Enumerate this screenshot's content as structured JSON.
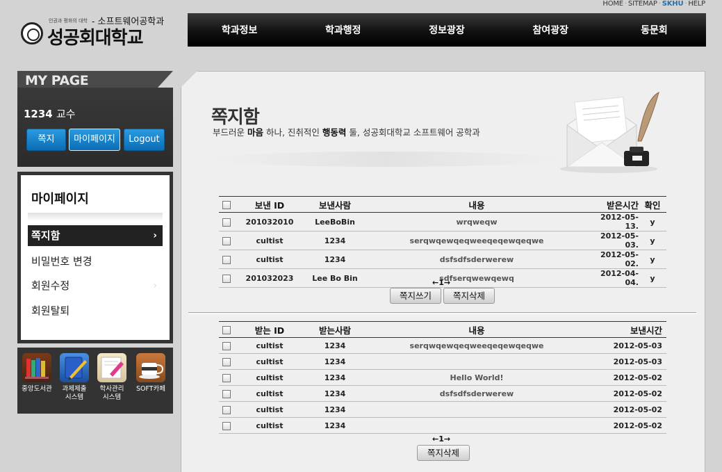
{
  "util_links": [
    "HOME",
    "SITEMAP",
    "SKHU",
    "HELP"
  ],
  "logo": {
    "tagline": "인권과 평화의 대학",
    "dept": "- 소프트웨어공학과",
    "name": "성공회대학교"
  },
  "nav": [
    "학과정보",
    "학과행정",
    "정보광장",
    "참여광장",
    "동문회"
  ],
  "mypage": {
    "title": "MY PAGE",
    "user_id": "1234",
    "user_role": "교수",
    "buttons": [
      "쪽지",
      "마이페이지",
      "Logout"
    ]
  },
  "menu": {
    "title": "마이페이지",
    "items": [
      "쪽지함",
      "비밀번호 변경",
      "회원수정",
      "회원탈퇴"
    ]
  },
  "quick_links": [
    "중앙도서관",
    "과제제출\n시스템",
    "학사관리\n시스템",
    "SOFT카페"
  ],
  "page": {
    "title": "쪽지함",
    "subtitle_parts": [
      "부드러운 ",
      "마음",
      " 하나, 진취적인 ",
      "행동력",
      " 둘, 성공회대학교 소프트웨어 공학과"
    ]
  },
  "received": {
    "headers": [
      "보낸 ID",
      "보낸사람",
      "내용",
      "받은시간",
      "확인"
    ],
    "rows": [
      [
        "201032010",
        "LeeBoBin",
        "wrqweqw",
        "2012-05-13.",
        "y"
      ],
      [
        "cultist",
        "1234",
        "serqwqewqeqweeqeqewqeqwe",
        "2012-05-03.",
        "y"
      ],
      [
        "cultist",
        "1234",
        "dsfsdfsderwerew",
        "2012-05-02.",
        "y"
      ],
      [
        "201032023",
        "Lee Bo Bin",
        "sdfserqwewqewq",
        "2012-04-04.",
        "y"
      ]
    ],
    "pager": "←1→",
    "buttons": [
      "쪽지쓰기",
      "쪽지삭제"
    ]
  },
  "sent": {
    "headers": [
      "받는 ID",
      "받는사람",
      "내용",
      "보낸시간"
    ],
    "rows": [
      [
        "cultist",
        "1234",
        "serqwqewqeqweeqeqewqeqwe",
        "2012-05-03"
      ],
      [
        "cultist",
        "1234",
        "",
        "2012-05-03"
      ],
      [
        "cultist",
        "1234",
        "Hello World!",
        "2012-05-02"
      ],
      [
        "cultist",
        "1234",
        "dsfsdfsderwerew",
        "2012-05-02"
      ],
      [
        "cultist",
        "1234",
        "",
        "2012-05-02"
      ],
      [
        "cultist",
        "1234",
        "",
        "2012-05-02"
      ]
    ],
    "pager": "←1→",
    "buttons": [
      "쪽지삭제"
    ]
  }
}
